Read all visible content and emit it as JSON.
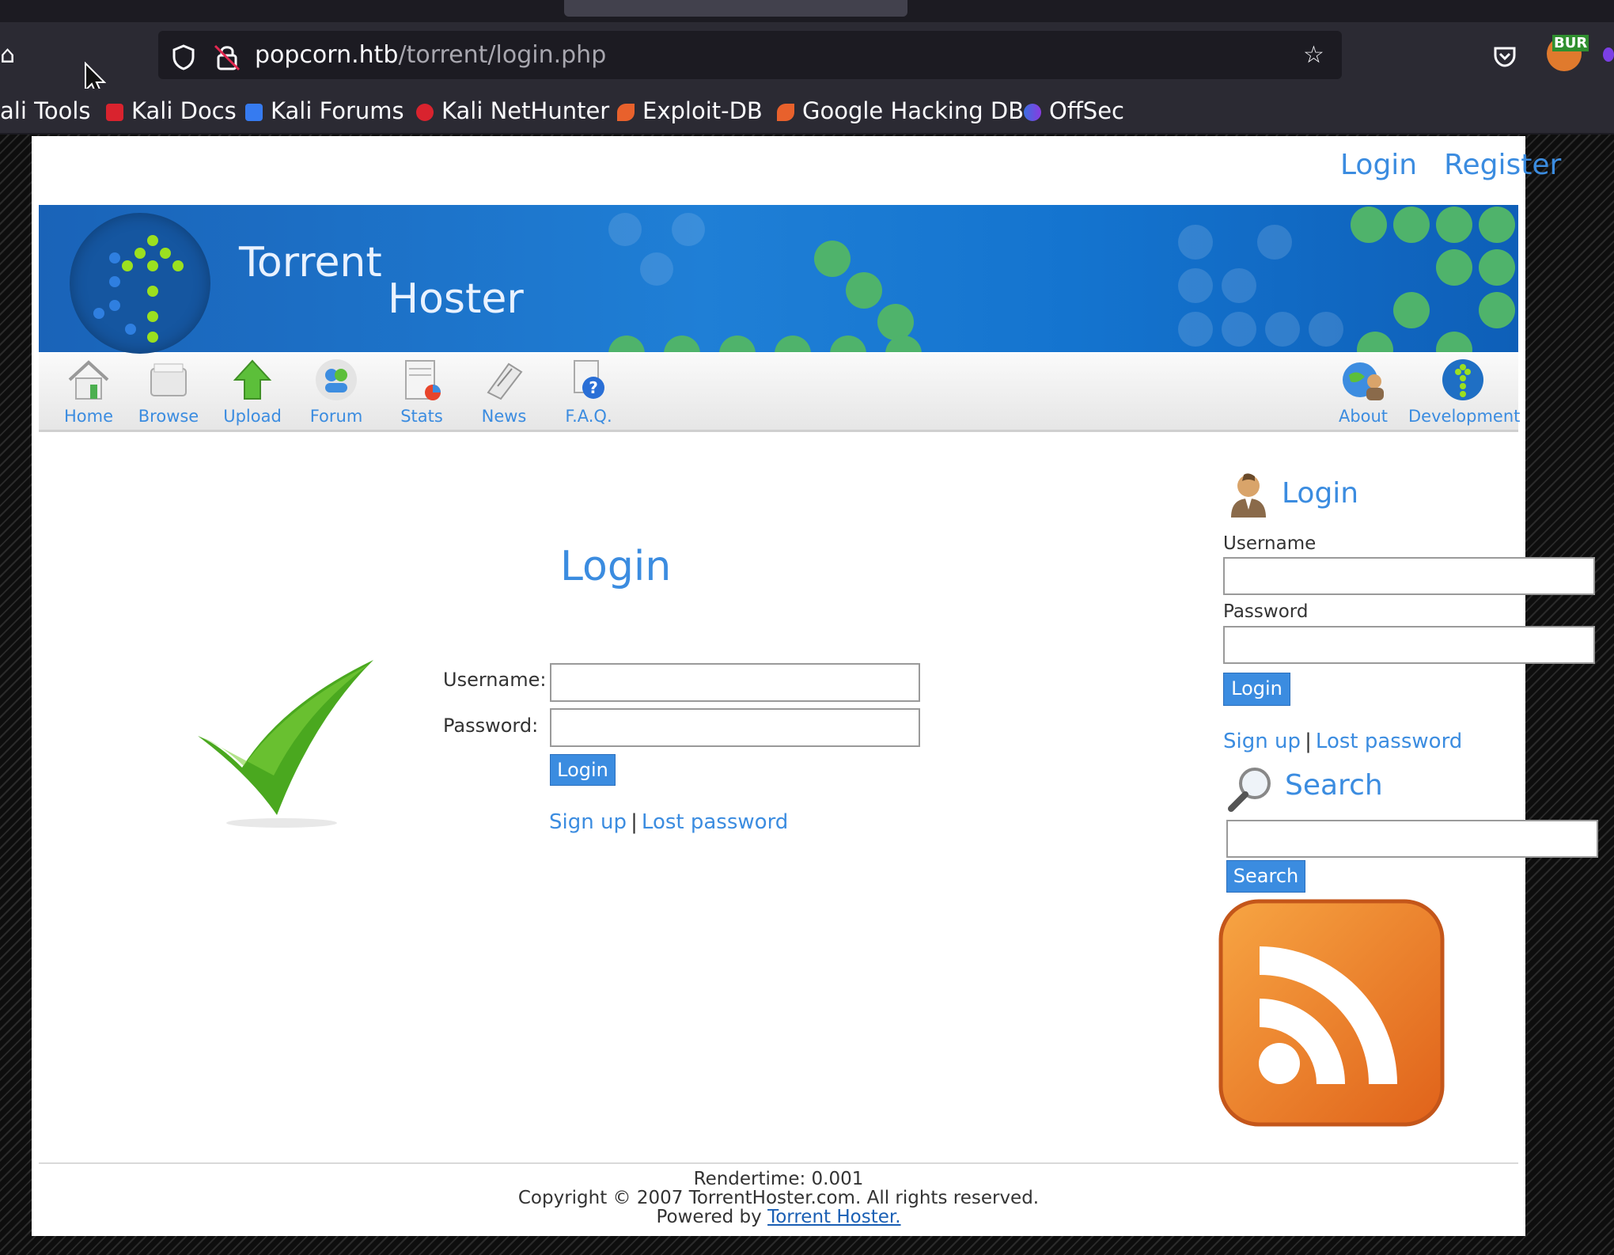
{
  "browser": {
    "url_host": "popcorn.htb",
    "url_path": "/torrent/login.php",
    "bookmarks": [
      "ali Tools",
      "Kali Docs",
      "Kali Forums",
      "Kali NetHunter",
      "Exploit-DB",
      "Google Hacking DB",
      "OffSec"
    ],
    "extension_badge": "BUR"
  },
  "top_links": {
    "login": "Login",
    "register": "Register"
  },
  "banner": {
    "title_1": "Torrent",
    "title_2": "Hoster"
  },
  "nav": {
    "items": [
      "Home",
      "Browse",
      "Upload",
      "Forum",
      "Stats",
      "News",
      "F.A.Q."
    ],
    "right_items": [
      "About",
      "Development"
    ]
  },
  "main_login": {
    "heading": "Login",
    "username_label": "Username:",
    "password_label": "Password:",
    "username_value": "",
    "password_value": "",
    "button": "Login",
    "signup": "Sign up",
    "separator": "|",
    "lost_password": "Lost password"
  },
  "sidebar": {
    "login_heading": "Login",
    "username_label": "Username",
    "password_label": "Password",
    "button": "Login",
    "signup": "Sign up",
    "separator": "|",
    "lost_password": "Lost password",
    "search_heading": "Search",
    "search_value": "",
    "search_button": "Search"
  },
  "footer": {
    "rendertime": "Rendertime: 0.001",
    "copyright": "Copyright © 2007 TorrentHoster.com. All rights reserved.",
    "powered_prefix": "Powered by",
    "powered_link": "Torrent Hoster."
  },
  "colors": {
    "link": "#3b8ce0",
    "button": "#3b8ce0",
    "check_green": "#4aa81f",
    "rss_orange": "#f08a24"
  }
}
